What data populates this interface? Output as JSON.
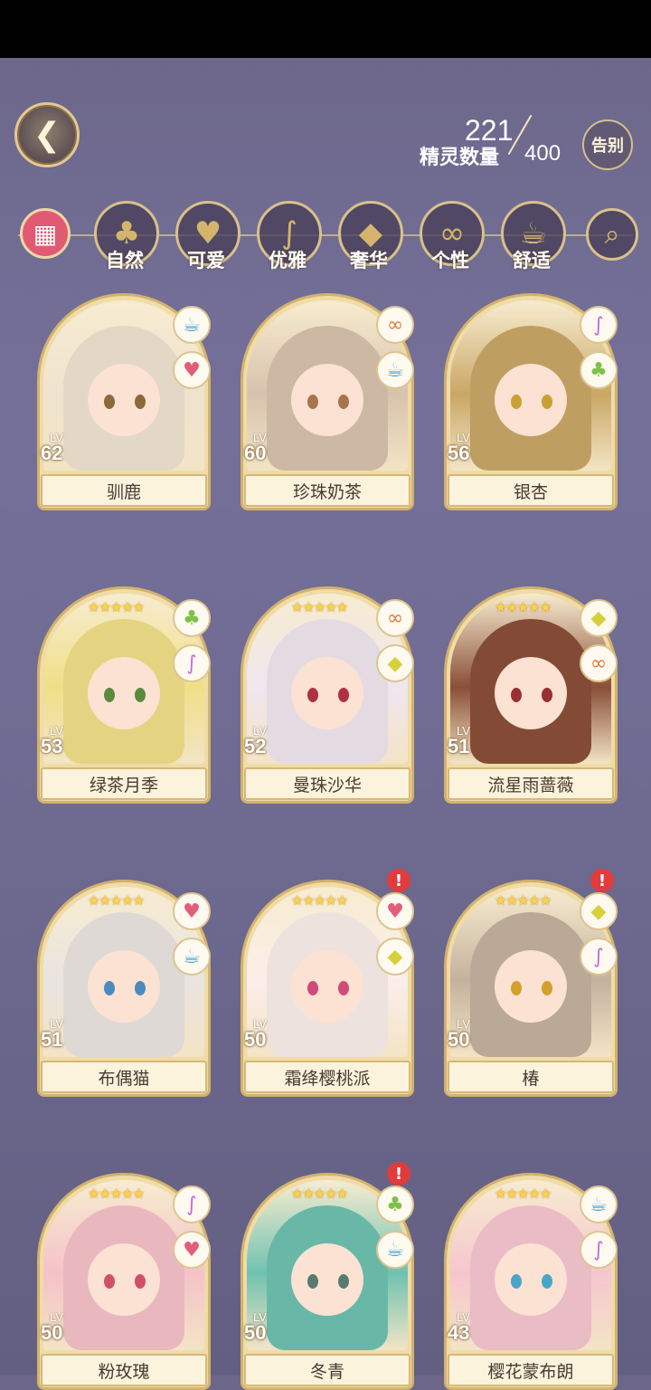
{
  "header": {
    "back_icon": "back-wing-icon",
    "count_current": "221",
    "count_max": "400",
    "count_label": "精灵数量",
    "farewell_label": "告别"
  },
  "filters": [
    {
      "label": "自然",
      "icon": "clover-icon"
    },
    {
      "label": "可爱",
      "icon": "heart-icon"
    },
    {
      "label": "优雅",
      "icon": "swan-icon"
    },
    {
      "label": "奢华",
      "icon": "diamond-icon"
    },
    {
      "label": "个性",
      "icon": "glasses-icon"
    },
    {
      "label": "舒适",
      "icon": "teacup-icon"
    }
  ],
  "cards": [
    {
      "name": "驯鹿",
      "level": "62",
      "attrs": [
        "teacup",
        "heart"
      ],
      "alert": false,
      "hair": "#efe3cf",
      "eye": "#8a6a3a",
      "stars": ""
    },
    {
      "name": "珍珠奶茶",
      "level": "60",
      "attrs": [
        "glasses",
        "teacup"
      ],
      "alert": false,
      "hair": "#d8c2ad",
      "eye": "#a8744b",
      "stars": ""
    },
    {
      "name": "银杏",
      "level": "56",
      "attrs": [
        "swan",
        "clover"
      ],
      "alert": false,
      "hair": "#c9a766",
      "eye": "#caa032",
      "stars": ""
    },
    {
      "name": "绿茶月季",
      "level": "53",
      "attrs": [
        "clover",
        "swan"
      ],
      "alert": false,
      "hair": "#f0df88",
      "eye": "#5a8a3e",
      "stars": "★★★★★"
    },
    {
      "name": "曼珠沙华",
      "level": "52",
      "attrs": [
        "glasses",
        "diamond"
      ],
      "alert": false,
      "hair": "#f0e6ee",
      "eye": "#b03040",
      "stars": "★★★★★"
    },
    {
      "name": "流星雨蔷薇",
      "level": "51",
      "attrs": [
        "diamond",
        "glasses"
      ],
      "alert": false,
      "hair": "#8a4f38",
      "eye": "#9a3030",
      "stars": "★★★★★"
    },
    {
      "name": "布偶猫",
      "level": "51",
      "attrs": [
        "heart",
        "teacup"
      ],
      "alert": false,
      "hair": "#eae4e0",
      "eye": "#4b8ac0",
      "stars": "★★★★★"
    },
    {
      "name": "霜绛樱桃派",
      "level": "50",
      "attrs": [
        "heart",
        "diamond"
      ],
      "alert": true,
      "hair": "#fbeeea",
      "eye": "#d04a7a",
      "stars": "★★★★★"
    },
    {
      "name": "椿",
      "level": "50",
      "attrs": [
        "diamond",
        "swan"
      ],
      "alert": true,
      "hair": "#c4b29e",
      "eye": "#d2a02c",
      "stars": "★★★★★"
    },
    {
      "name": "粉玫瑰",
      "level": "50",
      "attrs": [
        "swan",
        "heart"
      ],
      "alert": false,
      "hair": "#f5c2c8",
      "eye": "#d0506a",
      "stars": "★★★★★"
    },
    {
      "name": "冬青",
      "level": "50",
      "attrs": [
        "clover",
        "teacup"
      ],
      "alert": true,
      "hair": "#6fc2b0",
      "eye": "#5a7a70",
      "stars": "★★★★★"
    },
    {
      "name": "樱花蒙布朗",
      "level": "43",
      "attrs": [
        "teacup",
        "swan"
      ],
      "alert": false,
      "hair": "#f6c6cf",
      "eye": "#4aa6c8",
      "stars": "★★★★★"
    }
  ],
  "lv_text": "LV"
}
